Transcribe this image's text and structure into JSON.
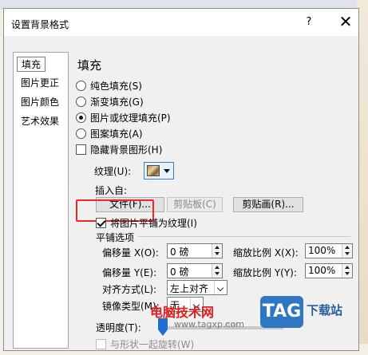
{
  "dialog": {
    "title": "设置背景格式",
    "help": "?",
    "close": "✕"
  },
  "sidebar": {
    "items": [
      {
        "label": "填充",
        "selected": true
      },
      {
        "label": "图片更正",
        "selected": false
      },
      {
        "label": "图片颜色",
        "selected": false
      },
      {
        "label": "艺术效果",
        "selected": false
      }
    ]
  },
  "fill": {
    "heading": "填充",
    "options": [
      {
        "label": "纯色填充(S)",
        "selected": false
      },
      {
        "label": "渐变填充(G)",
        "selected": false
      },
      {
        "label": "图片或纹理填充(P)",
        "selected": true
      },
      {
        "label": "图案填充(A)",
        "selected": false
      }
    ],
    "hide_bg_graphics": {
      "label": "隐藏背景图形(H)",
      "checked": false
    },
    "texture_label": "纹理(U):",
    "texture_icon": "texture-swatch-icon",
    "insert_from_label": "插入自:",
    "buttons": {
      "file": "文件(F)...",
      "clipboard": "剪贴板(C)",
      "clipart": "剪贴画(R)..."
    },
    "tile_checkbox": {
      "label": "将图片平铺为纹理(I)",
      "checked": true
    },
    "tile_options_title": "平铺选项",
    "offset_x_label": "偏移量 X(O):",
    "offset_x_value": "0 磅",
    "scale_x_label": "缩放比例 X(X):",
    "scale_x_value": "100%",
    "offset_y_label": "偏移量 Y(E):",
    "offset_y_value": "0 磅",
    "scale_y_label": "缩放比例 Y(Y):",
    "scale_y_value": "100%",
    "align_label": "对齐方式(L):",
    "align_value": "左上对齐",
    "mirror_label": "镜像类型(M):",
    "mirror_value": "无",
    "transparency_label": "透明度(T):",
    "transparency_value": "0%",
    "transparency_fraction": 0.0,
    "rotate_with_shape": {
      "label": "与形状一起旋转(W)",
      "checked": false
    }
  },
  "watermark": {
    "text": "电脑技术网",
    "url": "www.tagxp.com",
    "tag": "TAG",
    "site": "下载站"
  },
  "colors": {
    "accent": "#2b74d4",
    "highlight": "#ea2a2a"
  }
}
